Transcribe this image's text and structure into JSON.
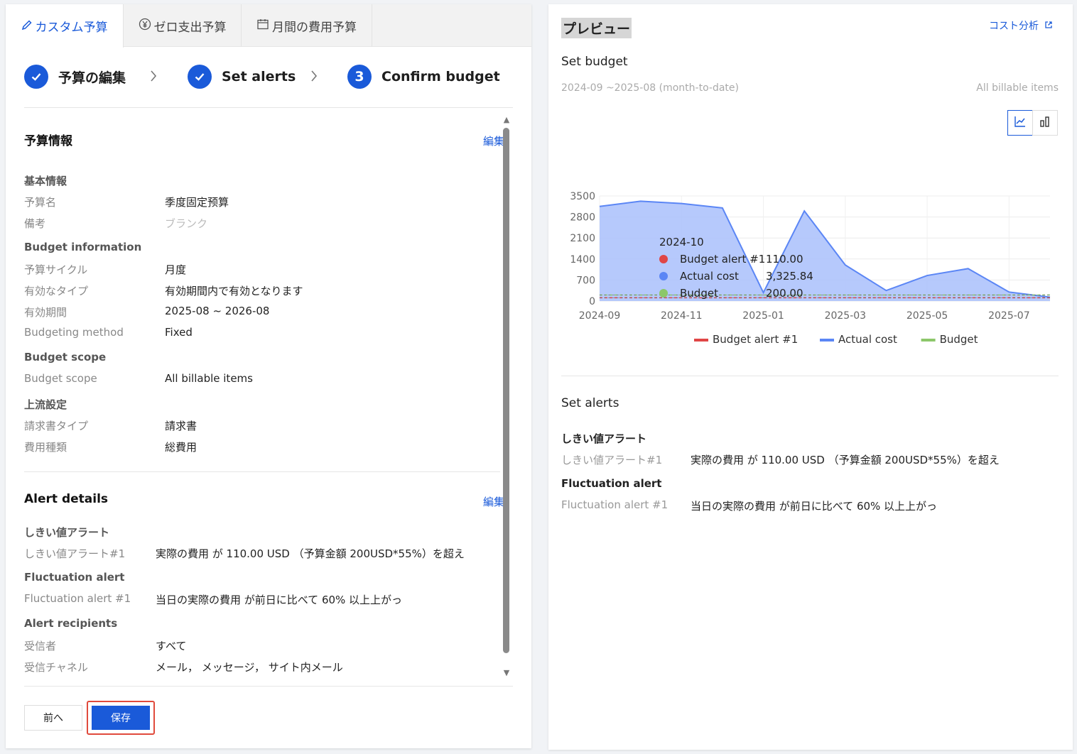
{
  "tabs": [
    {
      "label": "カスタム予算",
      "icon": "pencil-icon",
      "active": true
    },
    {
      "label": "ゼロ支出予算",
      "icon": "yen-circle-icon",
      "active": false
    },
    {
      "label": "月間の費用予算",
      "icon": "calendar-icon",
      "active": false
    }
  ],
  "steps": [
    {
      "label": "予算の編集",
      "state": "done"
    },
    {
      "label": "Set alerts",
      "state": "done"
    },
    {
      "label": "Confirm budget",
      "state": "current",
      "number": "3"
    }
  ],
  "budget_info": {
    "title": "予算情報",
    "edit": "編集",
    "groups": {
      "basic": "基本情報",
      "budget_information": "Budget information",
      "budget_scope": "Budget scope",
      "upstream": "上流設定"
    },
    "rows": {
      "name": {
        "k": "予算名",
        "v": "季度固定预算"
      },
      "note": {
        "k": "備考",
        "v": "ブランク"
      },
      "cycle": {
        "k": "予算サイクル",
        "v": "月度"
      },
      "type": {
        "k": "有効なタイプ",
        "v": "有効期間内で有効となります"
      },
      "period": {
        "k": "有効期間",
        "v": "2025-08 ~ 2026-08"
      },
      "method": {
        "k": "Budgeting method",
        "v": "Fixed"
      },
      "scope": {
        "k": "Budget scope",
        "v": "All billable items"
      },
      "bill_type": {
        "k": "請求書タイプ",
        "v": "請求書"
      },
      "cost_type": {
        "k": "費用種類",
        "v": "総費用"
      }
    }
  },
  "alert_details": {
    "title": "Alert details",
    "edit": "編集",
    "threshold_group": "しきい値アラート",
    "threshold_1": {
      "k": "しきい値アラート#1",
      "v": "実際の費用 が 110.00 USD （予算金額 200USD*55%）を超え"
    },
    "fluct_group": "Fluctuation alert",
    "fluct_1": {
      "k": "Fluctuation alert #1",
      "v": "当日の実際の費用 が前日に比べて 60% 以上上がっ"
    },
    "recipients_group": "Alert recipients",
    "recipients": {
      "k": "受信者",
      "v": "すべて"
    },
    "channels": {
      "k": "受信チャネル",
      "v": "メール， メッセージ， サイト内メール"
    }
  },
  "buttons": {
    "prev": "前へ",
    "save": "保存"
  },
  "preview": {
    "title": "プレビュー",
    "cost_analysis": "コスト分析",
    "set_budget": "Set budget",
    "range": "2024-09 ~2025-08 (month-to-date)",
    "scope": "All billable items",
    "set_alerts": "Set alerts",
    "threshold_group": "しきい値アラート",
    "threshold_1": {
      "k": "しきい値アラート#1",
      "v": "実際の費用 が 110.00 USD （予算金額 200USD*55%）を超え"
    },
    "fluct_group": "Fluctuation alert",
    "fluct_1": {
      "k": "Fluctuation alert #1",
      "v": "当日の実際の費用 が前日に比べて 60% 以上上がっ"
    }
  },
  "chart_data": {
    "type": "area",
    "x": [
      "2024-09",
      "2024-10",
      "2024-11",
      "2024-12",
      "2025-01",
      "2025-02",
      "2025-03",
      "2025-04",
      "2025-05",
      "2025-06",
      "2025-07",
      "2025-08"
    ],
    "x_ticks": [
      "2024-09",
      "2024-11",
      "2025-01",
      "2025-03",
      "2025-05",
      "2025-07"
    ],
    "y_ticks": [
      "3500",
      "2800",
      "2100",
      "1400",
      "700",
      "0"
    ],
    "ylim": [
      0,
      3500
    ],
    "series": [
      {
        "name": "Budget alert #1",
        "color": "#e04646",
        "values": [
          110,
          110,
          110,
          110,
          110,
          110,
          110,
          110,
          110,
          110,
          110,
          110
        ]
      },
      {
        "name": "Actual cost",
        "color": "#5b86f5",
        "values": [
          3150,
          3325.84,
          3250,
          3100,
          280,
          3000,
          1200,
          350,
          850,
          1080,
          300,
          130
        ]
      },
      {
        "name": "Budget",
        "color": "#8cc76a",
        "values": [
          200,
          200,
          200,
          200,
          200,
          200,
          200,
          200,
          200,
          200,
          200,
          200
        ]
      }
    ],
    "tooltip": {
      "title": "2024-10",
      "rows": [
        {
          "name": "Budget alert #1",
          "value": "110.00",
          "color": "#e04646"
        },
        {
          "name": "Actual cost",
          "value": "3,325.84",
          "color": "#5b86f5"
        },
        {
          "name": "Budget",
          "value": "200.00",
          "color": "#8cc76a"
        }
      ]
    },
    "legend": "bottom"
  }
}
